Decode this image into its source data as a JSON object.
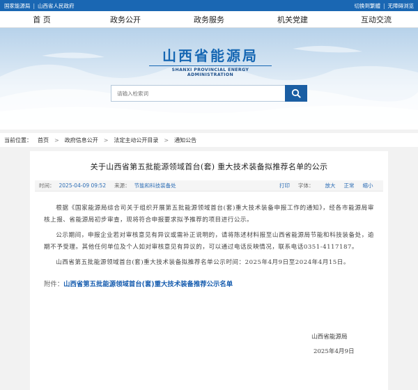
{
  "topbar": {
    "left_links": [
      "国家能源局",
      "山西省人民政府"
    ],
    "right_links": [
      "切换到繁體",
      "无障碍浏览"
    ]
  },
  "nav": {
    "items": [
      "首 页",
      "政务公开",
      "政务服务",
      "机关党建",
      "互动交流"
    ]
  },
  "banner": {
    "logo_cn": "山西省能源局",
    "logo_en": "SHANXI PROVINCIAL ENERGY ADMINISTRATION",
    "search_placeholder": "请输入检索词",
    "search_icon": "search-icon"
  },
  "breadcrumb": {
    "label": "当前位置：",
    "items": [
      "首页",
      "政府信息公开",
      "法定主动公开目录",
      "通知公告"
    ]
  },
  "article": {
    "title": "关于山西省第五批能源领域首台(套) 重大技术装备拟推荐名单的公示",
    "meta": {
      "time_label": "时间：",
      "time_value": "2025-04-09 09:52",
      "source_label": "来源：",
      "source_value": "节能和科技装备处",
      "print": "打印",
      "font_label": "字体：",
      "font_large": "放大",
      "font_normal": "正常",
      "font_small": "缩小"
    },
    "paragraphs": [
      "根据《国家能源局综合司关于组织开展第五批能源领域首台(套)重大技术装备申报工作的通知》，经各市能源局审核上报、省能源局初步审查，现将符合申报要求拟予推荐的项目进行公示。",
      "公示期间，申报企业若对审核意见有异议或需补正说明的，请将陈述材料报至山西省能源局节能和科技装备处，逾期不予受理。其他任何单位及个人如对审核意见有异议的，可以通过电话反映情况，联系电话0351-4117187。",
      "山西省第五批能源领域首台(套)重大技术装备拟推荐名单公示时间：2025年4月9日至2024年4月15日。"
    ],
    "attachment_label": "附件：",
    "attachment_link": "山西省第五批能源领域首台(套)重大技术装备推荐公示名单",
    "signature": "山西省能源局",
    "date": "2025年4月9日"
  }
}
